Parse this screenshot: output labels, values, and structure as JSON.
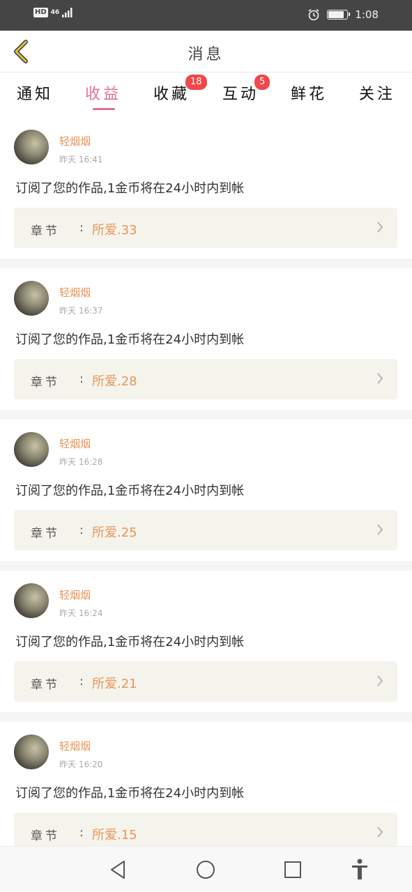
{
  "status_bar": {
    "hd": "HD",
    "network": "46",
    "time": "1:08",
    "battery_level": 0.85
  },
  "header": {
    "title": "消息",
    "back_icon": "chevron-left-icon"
  },
  "tabs": [
    {
      "label": "通知",
      "badge": ""
    },
    {
      "label": "收益",
      "badge": "",
      "active": true
    },
    {
      "label": "收藏",
      "badge": "18"
    },
    {
      "label": "互动",
      "badge": "5"
    },
    {
      "label": "鲜花",
      "badge": ""
    },
    {
      "label": "关注",
      "badge": ""
    }
  ],
  "feed": {
    "items": [
      {
        "username": "轻烟烟",
        "time": "昨天 16:41",
        "message": "订阅了您的作品,1金币将在24小时内到帐",
        "chapter_label": "章节",
        "chapter_colon": ":",
        "chapter_name": "所爱.33"
      },
      {
        "username": "轻烟烟",
        "time": "昨天 16:37",
        "message": "订阅了您的作品,1金币将在24小时内到帐",
        "chapter_label": "章节",
        "chapter_colon": ":",
        "chapter_name": "所爱.28"
      },
      {
        "username": "轻烟烟",
        "time": "昨天 16:28",
        "message": "订阅了您的作品,1金币将在24小时内到帐",
        "chapter_label": "章节",
        "chapter_colon": ":",
        "chapter_name": "所爱.25"
      },
      {
        "username": "轻烟烟",
        "time": "昨天 16:24",
        "message": "订阅了您的作品,1金币将在24小时内到帐",
        "chapter_label": "章节",
        "chapter_colon": ":",
        "chapter_name": "所爱.21"
      },
      {
        "username": "轻烟烟",
        "time": "昨天 16:20",
        "message": "订阅了您的作品,1金币将在24小时内到帐",
        "chapter_label": "章节",
        "chapter_colon": ":",
        "chapter_name": "所爱.15"
      }
    ]
  },
  "nav_bar": {
    "icons": [
      "back-triangle-icon",
      "home-circle-icon",
      "recents-square-icon",
      "accessibility-icon"
    ]
  },
  "colors": {
    "accent": "#e0709b",
    "orange_text": "#e8955a",
    "badge": "#f04848",
    "status_bar": "#454545"
  }
}
